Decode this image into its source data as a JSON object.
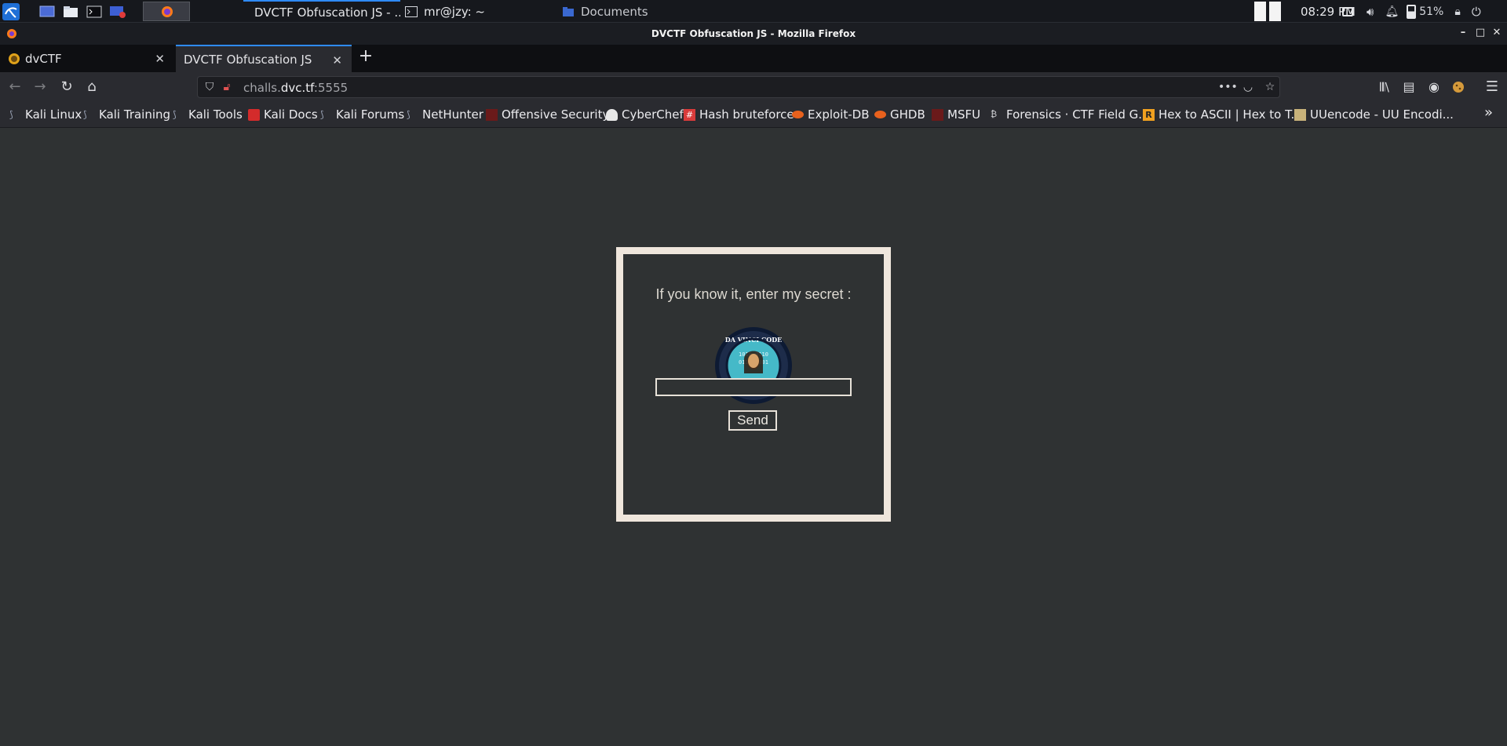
{
  "taskbar": {
    "tasks": [
      {
        "label": "DVCTF Obfuscation JS - ..."
      },
      {
        "label": "mr@jzy: ~"
      },
      {
        "label": "Documents"
      }
    ],
    "clock": "08:29 PM",
    "battery": "51%"
  },
  "window": {
    "title": "DVCTF Obfuscation JS - Mozilla Firefox"
  },
  "tabs": [
    {
      "label": "dvCTF"
    },
    {
      "label": "DVCTF Obfuscation JS"
    }
  ],
  "urlbar": {
    "url_prefix": "challs.",
    "url_domain": "dvc.tf",
    "url_suffix": ":5555"
  },
  "bookmarks": [
    {
      "label": "Kali Linux"
    },
    {
      "label": "Kali Training"
    },
    {
      "label": "Kali Tools"
    },
    {
      "label": "Kali Docs"
    },
    {
      "label": "Kali Forums"
    },
    {
      "label": "NetHunter"
    },
    {
      "label": "Offensive Security"
    },
    {
      "label": "CyberChef"
    },
    {
      "label": "Hash bruteforce"
    },
    {
      "label": "Exploit-DB"
    },
    {
      "label": "GHDB"
    },
    {
      "label": "MSFU"
    },
    {
      "label": "Forensics · CTF Field G..."
    },
    {
      "label": "Hex to ASCII | Hex to T..."
    },
    {
      "label": "UUencode - UU Encodi..."
    }
  ],
  "page": {
    "prompt": "If you know it, enter my secret :",
    "logo_text": "DA VINCI CODE",
    "secret_value": "",
    "send_label": "Send"
  },
  "colors": {
    "page_bg": "#2f3233",
    "card_border": "#efe6dc",
    "accent": "#2f8bff"
  }
}
